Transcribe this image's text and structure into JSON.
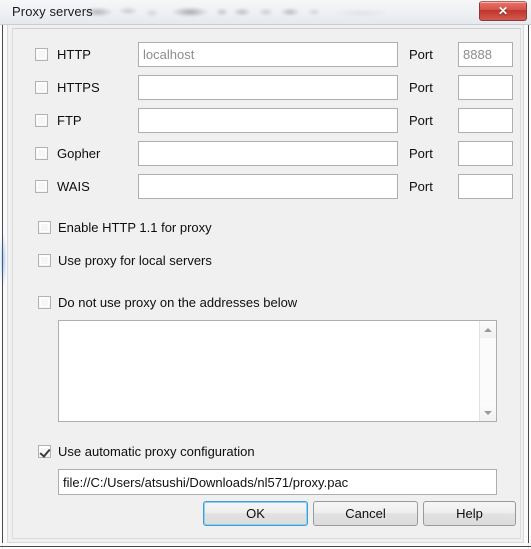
{
  "window": {
    "title": "Proxy servers",
    "close_label": "✕",
    "close_icon": "close-icon"
  },
  "proxy_rows": [
    {
      "id": "http",
      "label": "HTTP",
      "checked": false,
      "host": "localhost",
      "host_dim": true,
      "port_label": "Port",
      "port": "8888",
      "port_dim": true
    },
    {
      "id": "https",
      "label": "HTTPS",
      "checked": false,
      "host": "",
      "host_dim": false,
      "port_label": "Port",
      "port": "",
      "port_dim": false
    },
    {
      "id": "ftp",
      "label": "FTP",
      "checked": false,
      "host": "",
      "host_dim": false,
      "port_label": "Port",
      "port": "",
      "port_dim": false
    },
    {
      "id": "gopher",
      "label": "Gopher",
      "checked": false,
      "host": "",
      "host_dim": false,
      "port_label": "Port",
      "port": "",
      "port_dim": false
    },
    {
      "id": "wais",
      "label": "WAIS",
      "checked": false,
      "host": "",
      "host_dim": false,
      "port_label": "Port",
      "port": "",
      "port_dim": false
    }
  ],
  "options": {
    "enable_http11": {
      "label": "Enable HTTP 1.1 for proxy",
      "checked": false
    },
    "local_servers": {
      "label": "Use proxy for local servers",
      "checked": false
    },
    "no_proxy": {
      "label": "Do not use proxy on the addresses below",
      "checked": false
    }
  },
  "exceptions": {
    "value": "",
    "scrollbar": {
      "up_icon": "scroll-up-arrow-icon",
      "down_icon": "scroll-down-arrow-icon"
    }
  },
  "auto_config": {
    "label": "Use automatic proxy configuration",
    "checked": true,
    "url": "file://C:/Users/atsushi/Downloads/nl571/proxy.pac"
  },
  "buttons": {
    "ok": "OK",
    "cancel": "Cancel",
    "help": "Help"
  },
  "colors": {
    "dialog_bg": "#f0f0f0",
    "focus_blue": "#3c9fd8",
    "close_red": "#c0352c",
    "dim_text": "#8d8d8d"
  }
}
